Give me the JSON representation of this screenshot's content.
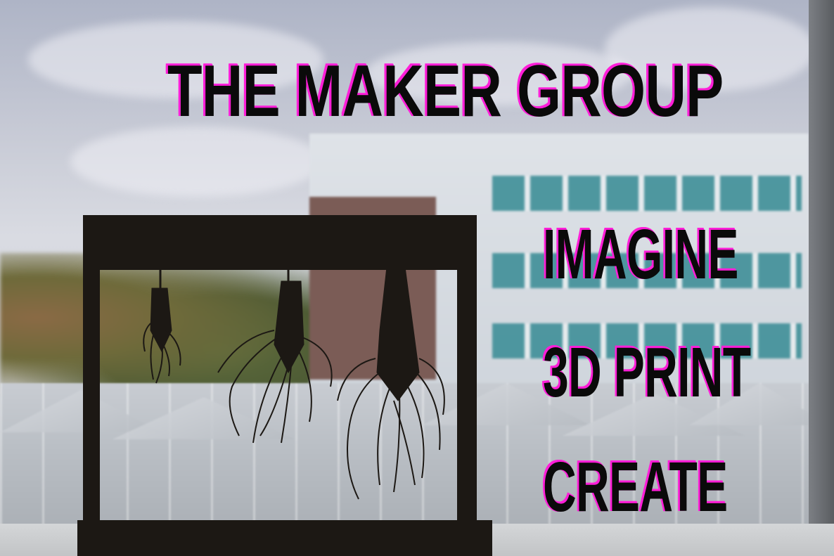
{
  "poster": {
    "title": "THE MAKER GROUP",
    "taglines": [
      "IMAGINE",
      "3D PRINT",
      "CREATE"
    ]
  },
  "colors": {
    "text": "#0a0a0a",
    "text_shadow": "#ff1ed8",
    "stand": "#1c1814"
  },
  "photo": {
    "subject": "3D-printed plant root models hanging from a wooden stand in front of a window"
  }
}
